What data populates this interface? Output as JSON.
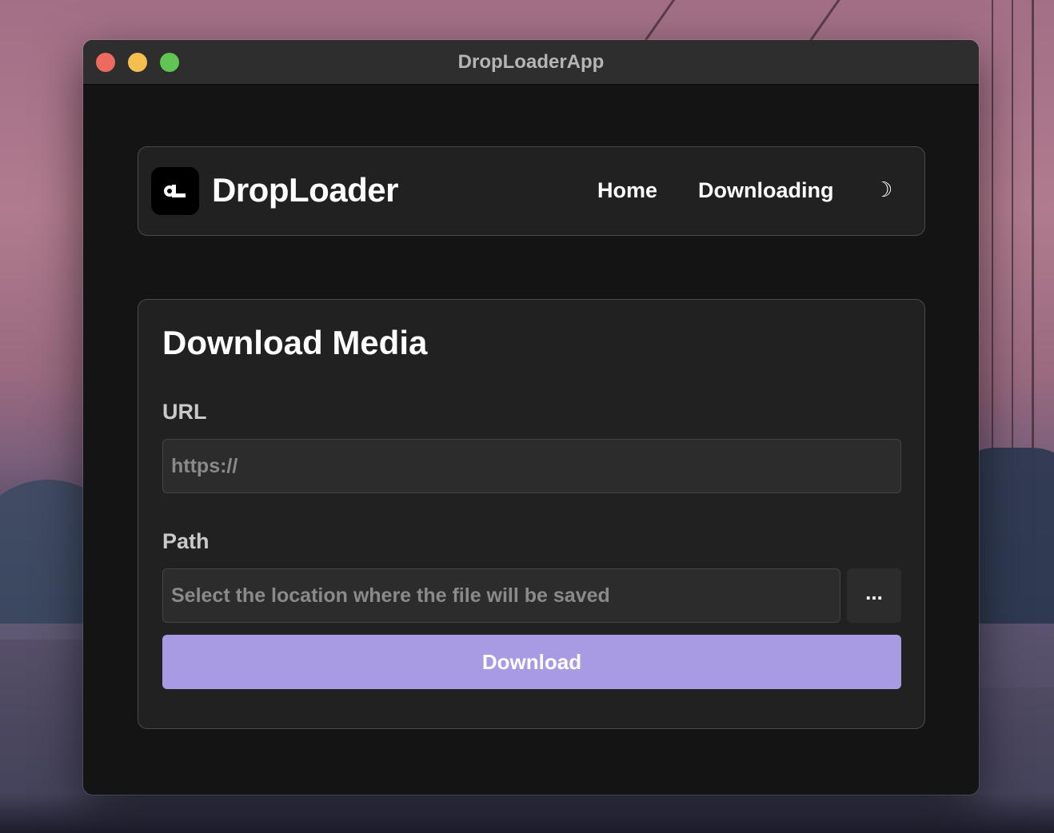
{
  "window": {
    "title": "DropLoaderApp"
  },
  "navbar": {
    "brand": "DropLoader",
    "home_label": "Home",
    "downloading_label": "Downloading",
    "theme_toggle_icon": "☽"
  },
  "form": {
    "title": "Download Media",
    "url_label": "URL",
    "url_placeholder": "https://",
    "url_value": "",
    "path_label": "Path",
    "path_placeholder": "Select the location where the file will be saved",
    "path_value": "",
    "browse_label": "...",
    "download_label": "Download"
  },
  "colors": {
    "accent": "#a89be3",
    "window_bg": "#141414",
    "panel_bg": "#212121",
    "titlebar_bg": "#2e2e2e"
  },
  "icons": {
    "logo": "droploader-logo-icon",
    "theme": "moon-icon",
    "browse": "ellipsis-icon"
  }
}
